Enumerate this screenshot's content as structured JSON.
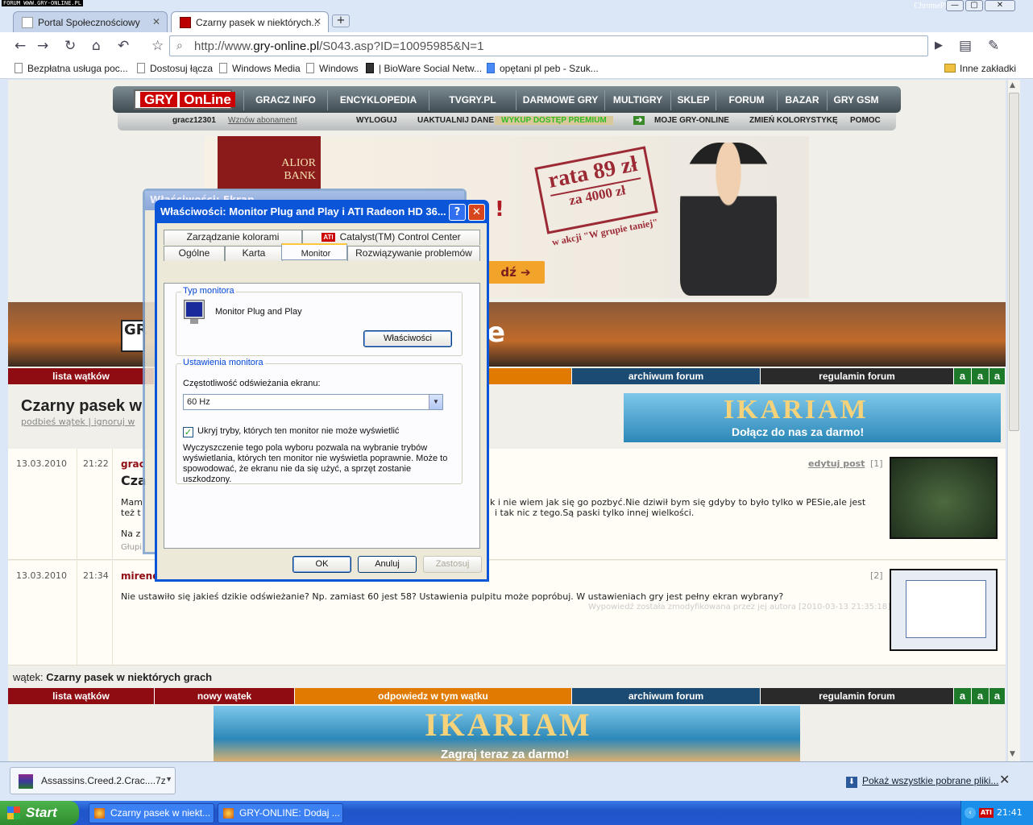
{
  "watermark": "FORUM WWW.GRY-ONLINE.PL",
  "browser": {
    "brand": "ChromePlus",
    "tabs": [
      {
        "title": "Portal Społecznościowy",
        "close": "✕"
      },
      {
        "title": "Czarny pasek w niektórych...",
        "close": "✕"
      }
    ],
    "new_tab": "+",
    "url_prefix": "http://www.",
    "url_host": "gry-online.pl",
    "url_path": "/S043.asp?ID=10095985&N=1",
    "bookmarks": [
      "Bezpłatna usługa poc...",
      "Dostosuj łącza",
      "Windows Media",
      "Windows",
      "| BioWare Social Netw...",
      "opętani pl peb - Szuk..."
    ],
    "bookmarks_other": "Inne zakładki"
  },
  "site": {
    "logo_left": "GRY",
    "logo_right": "OnLine",
    "nav": [
      "GRACZ INFO",
      "ENCYKLOPEDIA",
      "TVGRY.PL",
      "DARMOWE GRY",
      "MULTIGRY",
      "SKLEP",
      "FORUM",
      "BAZAR",
      "GRY GSM"
    ],
    "user": "gracz12301",
    "renew": "Wznów abonament",
    "subnav": [
      "WYLOGUJ",
      "UAKTUALNIJ DANE",
      "WYKUP DOSTĘP PREMIUM",
      "MOJE GRY-ONLINE",
      "ZMIEŃ KOLORYSTYKĘ",
      "POMOC"
    ]
  },
  "banner_alior": {
    "brand1": "ALIOR",
    "brand2": "BANK",
    "rate": "rata 89 zł",
    "amount": "za 4000 zł",
    "promo": "w akcji \"W grupie taniej\"",
    "button": "dź",
    "exclaim": "!"
  },
  "forum_tabs": {
    "list": "lista wątków",
    "new": "nowy wątek",
    "reply": "odpowiedz w tym wątku",
    "archive": "archiwum forum",
    "rules": "regulamin forum",
    "font": [
      "a",
      "a",
      "a"
    ]
  },
  "thread": {
    "title": "Czarny pasek w",
    "raise": "podbieś wątek",
    "ignore": "ignoruj w",
    "footer_prefix": "wątek:",
    "footer_title": "Czarny pasek w niektórych grach"
  },
  "ikariam1": {
    "title": "IKARIAM",
    "cta": "Dołącz do nas za darmo!"
  },
  "ikariam2": {
    "title": "IKARIAM",
    "cta": "Zagraj teraz za darmo!"
  },
  "posts": [
    {
      "date": "13.03.2010",
      "time": "21:22",
      "author": "grac",
      "heading": "Cza",
      "line1a": "Mam",
      "line1b": "k i nie wiem jak się go pozbyć.Nie dziwił bym się gdyby to było tylko w PESie,ale jest",
      "line2a": "też t",
      "line2b": "i tak nic z tego.Są paski tylko innej wielkości.",
      "line3": "Na z",
      "line4": "Głupi",
      "edit": "edytuj post",
      "num": "[1]"
    },
    {
      "date": "13.03.2010",
      "time": "21:34",
      "author": "mirend",
      "text": "Nie ustawiło się jakieś dzikie odświeżanie? Np. zamiast 60 jest 58? Ustawienia pulpitu może popróbuj. W ustawieniach gry jest pełny ekran wybrany?",
      "note": "Wypowiedź została zmodyfikowana przez jej autora [2010-03-13 21:35:18]",
      "num": "[2]"
    }
  ],
  "dialog_back": {
    "title": "Właściwości: Ekran"
  },
  "dialog": {
    "title": "Właściwości: Monitor Plug and Play i ATI Radeon HD 36...",
    "tabs_row1": [
      "Zarządzanie kolorami",
      "Catalyst(TM) Control Center"
    ],
    "ati": "ATI",
    "tabs_row2": [
      "Ogólne",
      "Karta",
      "Monitor",
      "Rozwiązywanie problemów"
    ],
    "group1": "Typ monitora",
    "monitor_name": "Monitor Plug and Play",
    "properties_btn": "Właściwości",
    "group2": "Ustawienia monitora",
    "refresh_label": "Częstotliwość odświeżania ekranu:",
    "refresh_value": "60 Hz",
    "hide_modes": "Ukryj tryby, których ten monitor nie może wyświetlić",
    "warning": "Wyczyszczenie tego pola wyboru pozwala na wybranie trybów wyświetlania, których ten monitor nie wyświetla poprawnie. Może to spowodować, że ekranu nie da się użyć, a sprzęt zostanie uszkodzony.",
    "ok": "OK",
    "cancel": "Anuluj",
    "apply": "Zastosuj"
  },
  "downloads": {
    "file": "Assassins.Creed.2.Crac....7z",
    "show_all": "Pokaż wszystkie pobrane pliki...",
    "close": "✕"
  },
  "taskbar": {
    "start": "Start",
    "tasks": [
      "Czarny pasek w niekt...",
      "GRY-ONLINE: Dodaj ..."
    ],
    "ati": "ATI",
    "clock": "21:41"
  }
}
